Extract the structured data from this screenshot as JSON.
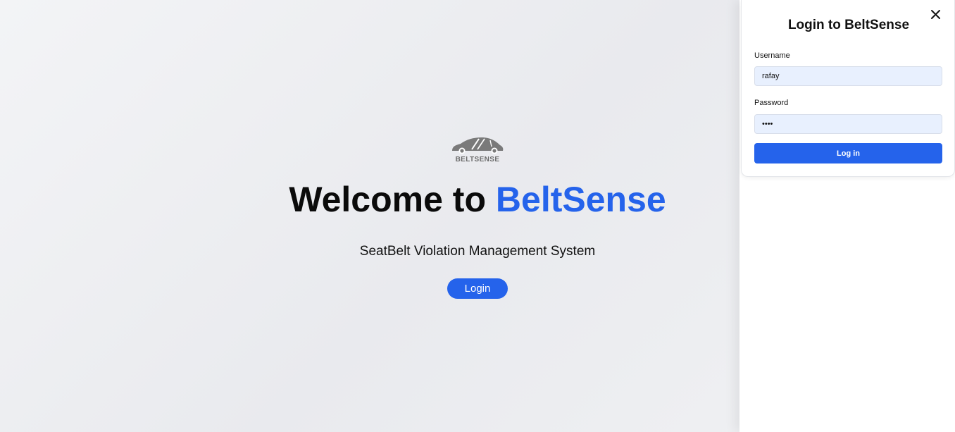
{
  "hero": {
    "logo_text": "BELTSENSE",
    "welcome_prefix": "Welcome to ",
    "welcome_brand": "BeltSense",
    "subtitle": "SeatBelt Violation Management System",
    "login_button": "Login"
  },
  "login_panel": {
    "title": "Login to BeltSense",
    "username_label": "Username",
    "username_value": "rafay",
    "password_label": "Password",
    "password_value": "••••",
    "submit_label": "Log in",
    "close_icon": "close-icon"
  },
  "colors": {
    "accent": "#2563eb",
    "input_bg": "#e8f0fe",
    "logo_gray": "#6b6b6b"
  }
}
